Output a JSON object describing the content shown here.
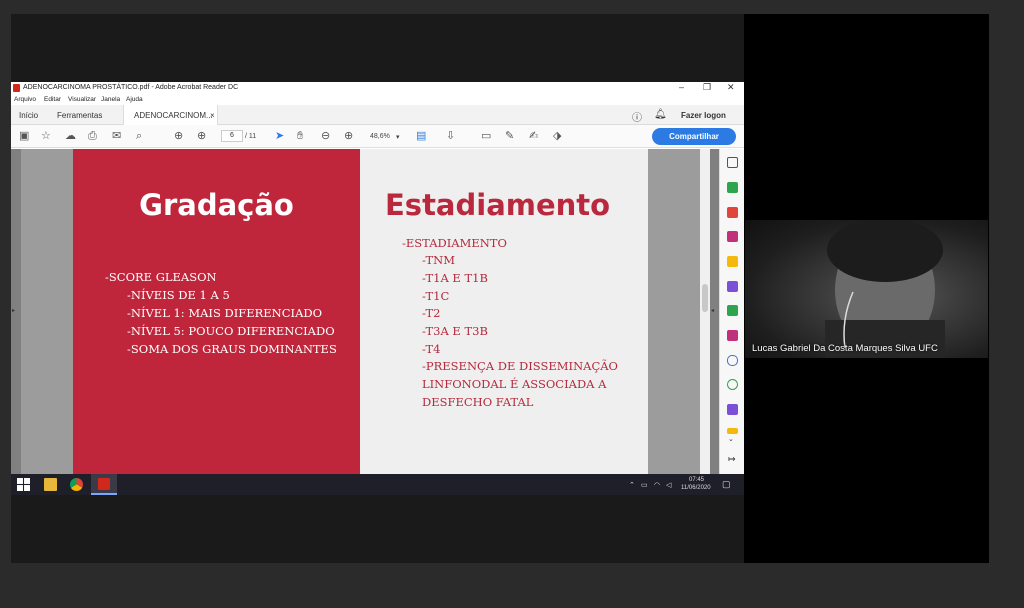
{
  "window": {
    "title": "ADENOCARCINOMA PROSTÁTICO.pdf - Adobe Acrobat Reader DC",
    "controls": [
      "–",
      "❐",
      "✕"
    ]
  },
  "menu": [
    "Arquivo",
    "Editar",
    "Visualizar",
    "Janela",
    "Ajuda"
  ],
  "tabs": {
    "home": "Início",
    "tools": "Ferramentas",
    "document": "ADENOCARCINOM...",
    "close": "×",
    "login": "Fazer logon"
  },
  "toolbar": {
    "page_current": "6",
    "page_total": "/ 11",
    "zoom": "48,6%",
    "share": "Compartilhar"
  },
  "slide_left": {
    "title": "Gradação",
    "lines": [
      "-SCORE GLEASON",
      "-NÍVEIS DE 1 A 5",
      "-NÍVEL 1: MAIS DIFERENCIADO",
      "-NÍVEL 5: POUCO DIFERENCIADO",
      "-SOMA DOS GRAUS DOMINANTES"
    ]
  },
  "slide_right": {
    "title": "Estadiamento",
    "lines": [
      "-ESTADIAMENTO",
      "-TNM",
      "-T1A E T1B",
      "-T1C",
      "-T2",
      "-T3A E T3B",
      "-T4",
      "-PRESENÇA DE DISSEMINAÇÃO",
      "LINFONODAL É ASSOCIADA A",
      "DESFECHO FATAL"
    ]
  },
  "taskbar": {
    "time": "07:45",
    "date": "11/06/2020"
  },
  "participant": {
    "name": "Lucas Gabriel Da Costa Marques Silva UFC"
  },
  "colors": {
    "slide_red": "#c0263b",
    "share_blue": "#2c7be5",
    "acrobat_red": "#d0281b"
  }
}
